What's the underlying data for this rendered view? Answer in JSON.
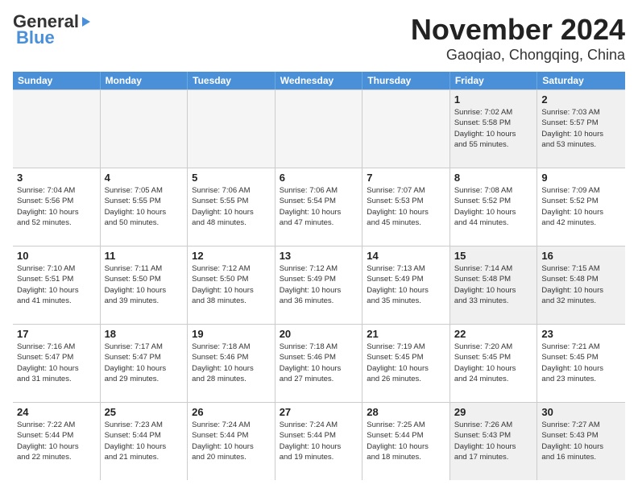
{
  "header": {
    "logo_line1": "General",
    "logo_line2": "Blue",
    "month_title": "November 2024",
    "location": "Gaoqiao, Chongqing, China"
  },
  "weekdays": [
    "Sunday",
    "Monday",
    "Tuesday",
    "Wednesday",
    "Thursday",
    "Friday",
    "Saturday"
  ],
  "rows": [
    [
      {
        "day": "",
        "empty": true
      },
      {
        "day": "",
        "empty": true
      },
      {
        "day": "",
        "empty": true
      },
      {
        "day": "",
        "empty": true
      },
      {
        "day": "",
        "empty": true
      },
      {
        "day": "1",
        "info": "Sunrise: 7:02 AM\nSunset: 5:58 PM\nDaylight: 10 hours\nand 55 minutes."
      },
      {
        "day": "2",
        "info": "Sunrise: 7:03 AM\nSunset: 5:57 PM\nDaylight: 10 hours\nand 53 minutes."
      }
    ],
    [
      {
        "day": "3",
        "info": "Sunrise: 7:04 AM\nSunset: 5:56 PM\nDaylight: 10 hours\nand 52 minutes."
      },
      {
        "day": "4",
        "info": "Sunrise: 7:05 AM\nSunset: 5:55 PM\nDaylight: 10 hours\nand 50 minutes."
      },
      {
        "day": "5",
        "info": "Sunrise: 7:06 AM\nSunset: 5:55 PM\nDaylight: 10 hours\nand 48 minutes."
      },
      {
        "day": "6",
        "info": "Sunrise: 7:06 AM\nSunset: 5:54 PM\nDaylight: 10 hours\nand 47 minutes."
      },
      {
        "day": "7",
        "info": "Sunrise: 7:07 AM\nSunset: 5:53 PM\nDaylight: 10 hours\nand 45 minutes."
      },
      {
        "day": "8",
        "info": "Sunrise: 7:08 AM\nSunset: 5:52 PM\nDaylight: 10 hours\nand 44 minutes."
      },
      {
        "day": "9",
        "info": "Sunrise: 7:09 AM\nSunset: 5:52 PM\nDaylight: 10 hours\nand 42 minutes."
      }
    ],
    [
      {
        "day": "10",
        "info": "Sunrise: 7:10 AM\nSunset: 5:51 PM\nDaylight: 10 hours\nand 41 minutes."
      },
      {
        "day": "11",
        "info": "Sunrise: 7:11 AM\nSunset: 5:50 PM\nDaylight: 10 hours\nand 39 minutes."
      },
      {
        "day": "12",
        "info": "Sunrise: 7:12 AM\nSunset: 5:50 PM\nDaylight: 10 hours\nand 38 minutes."
      },
      {
        "day": "13",
        "info": "Sunrise: 7:12 AM\nSunset: 5:49 PM\nDaylight: 10 hours\nand 36 minutes."
      },
      {
        "day": "14",
        "info": "Sunrise: 7:13 AM\nSunset: 5:49 PM\nDaylight: 10 hours\nand 35 minutes."
      },
      {
        "day": "15",
        "info": "Sunrise: 7:14 AM\nSunset: 5:48 PM\nDaylight: 10 hours\nand 33 minutes."
      },
      {
        "day": "16",
        "info": "Sunrise: 7:15 AM\nSunset: 5:48 PM\nDaylight: 10 hours\nand 32 minutes."
      }
    ],
    [
      {
        "day": "17",
        "info": "Sunrise: 7:16 AM\nSunset: 5:47 PM\nDaylight: 10 hours\nand 31 minutes."
      },
      {
        "day": "18",
        "info": "Sunrise: 7:17 AM\nSunset: 5:47 PM\nDaylight: 10 hours\nand 29 minutes."
      },
      {
        "day": "19",
        "info": "Sunrise: 7:18 AM\nSunset: 5:46 PM\nDaylight: 10 hours\nand 28 minutes."
      },
      {
        "day": "20",
        "info": "Sunrise: 7:18 AM\nSunset: 5:46 PM\nDaylight: 10 hours\nand 27 minutes."
      },
      {
        "day": "21",
        "info": "Sunrise: 7:19 AM\nSunset: 5:45 PM\nDaylight: 10 hours\nand 26 minutes."
      },
      {
        "day": "22",
        "info": "Sunrise: 7:20 AM\nSunset: 5:45 PM\nDaylight: 10 hours\nand 24 minutes."
      },
      {
        "day": "23",
        "info": "Sunrise: 7:21 AM\nSunset: 5:45 PM\nDaylight: 10 hours\nand 23 minutes."
      }
    ],
    [
      {
        "day": "24",
        "info": "Sunrise: 7:22 AM\nSunset: 5:44 PM\nDaylight: 10 hours\nand 22 minutes."
      },
      {
        "day": "25",
        "info": "Sunrise: 7:23 AM\nSunset: 5:44 PM\nDaylight: 10 hours\nand 21 minutes."
      },
      {
        "day": "26",
        "info": "Sunrise: 7:24 AM\nSunset: 5:44 PM\nDaylight: 10 hours\nand 20 minutes."
      },
      {
        "day": "27",
        "info": "Sunrise: 7:24 AM\nSunset: 5:44 PM\nDaylight: 10 hours\nand 19 minutes."
      },
      {
        "day": "28",
        "info": "Sunrise: 7:25 AM\nSunset: 5:44 PM\nDaylight: 10 hours\nand 18 minutes."
      },
      {
        "day": "29",
        "info": "Sunrise: 7:26 AM\nSunset: 5:43 PM\nDaylight: 10 hours\nand 17 minutes."
      },
      {
        "day": "30",
        "info": "Sunrise: 7:27 AM\nSunset: 5:43 PM\nDaylight: 10 hours\nand 16 minutes."
      }
    ]
  ]
}
